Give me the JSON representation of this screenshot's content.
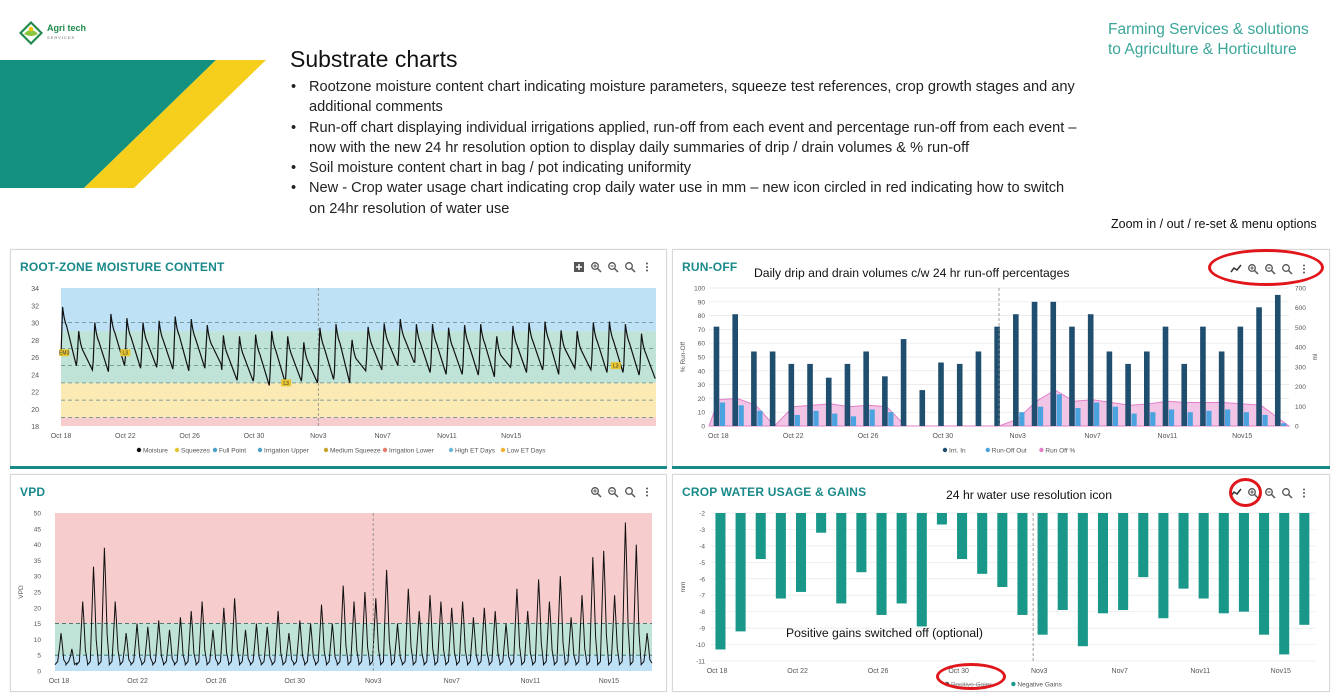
{
  "logo": {
    "name": "Agri tech",
    "sub": "SERVICES"
  },
  "tagline": {
    "line1": "Farming Services & solutions",
    "line2": "to Agriculture & Horticulture"
  },
  "slide": {
    "title": "Substrate charts",
    "bullets": [
      "Rootzone moisture content chart indicating moisture parameters, squeeze test references, crop growth stages and any additional comments",
      "Run-off chart displaying individual irrigations applied, run-off from each event and percentage run-off from each event – now with the new 24 hr resolution option to display daily summaries of drip / drain volumes & % run-off",
      "Soil moisture content chart in bag / pot indicating uniformity",
      "New - Crop water usage chart indicating crop daily water use in mm – new icon circled in red indicating how to switch on 24hr resolution of water use"
    ],
    "zoom_note": "Zoom in / out / re-set & menu options"
  },
  "panels": {
    "rootzone": {
      "title": "ROOT-ZONE MOISTURE CONTENT"
    },
    "runoff": {
      "title": "RUN-OFF",
      "annotation": "Daily drip and drain volumes  c/w 24 hr run-off percentages"
    },
    "vpd": {
      "title": "VPD"
    },
    "cwu": {
      "title": "CROP WATER USAGE & GAINS",
      "annotation": "24 hr water use resolution  icon",
      "annotation2": "Positive gains switched off (optional)"
    }
  },
  "colors": {
    "teal": "#19898a",
    "blue_band": "#bfe1f6",
    "green_band": "#bfe3d6",
    "yellow_band": "#fbeab4",
    "red_band": "#f6cccc",
    "drip_bar": "#1f4e6e",
    "runoff_bar": "#4aa3df",
    "runoff_pct": "#e27fc8",
    "cwu_bar": "#19988a",
    "ring": "#e0161b"
  },
  "icons": [
    "add-chart-icon",
    "zoom-in-icon",
    "zoom-out-icon",
    "zoom-reset-icon",
    "menu-icon",
    "resolution-24hr-icon"
  ],
  "chart_data": [
    {
      "id": "rootzone",
      "type": "line",
      "title": "ROOT-ZONE MOISTURE CONTENT",
      "x_ticks": [
        "Oct 18",
        "Oct 22",
        "Oct 26",
        "Oct 30",
        "Nov3",
        "Nov7",
        "Nov11",
        "Nov15"
      ],
      "y_ticks": [
        18,
        20,
        22,
        24,
        26,
        28,
        30,
        32,
        34
      ],
      "ylim": [
        18,
        34
      ],
      "bands": [
        {
          "from": 29,
          "to": 34,
          "color": "#bfe1f6"
        },
        {
          "from": 23,
          "to": 29,
          "color": "#bfe3d6"
        },
        {
          "from": 19,
          "to": 23,
          "color": "#fbeab4"
        },
        {
          "from": 18,
          "to": 19,
          "color": "#f6cccc"
        }
      ],
      "dashed_lines": [
        30,
        27,
        25,
        23,
        21,
        19
      ],
      "markers": [
        {
          "label": "EM3",
          "day": 0.2,
          "value": 26.5
        },
        {
          "label": "L3",
          "day": 4.0,
          "value": 26.5
        },
        {
          "label": "L3",
          "day": 14.0,
          "value": 23.0
        },
        {
          "label": "L3",
          "day": 34.5,
          "value": 25.0
        }
      ],
      "moisture_cycles": [
        [
          31.8,
          25.0
        ],
        [
          29.0,
          24.5
        ],
        [
          30.0,
          24.3
        ],
        [
          31.0,
          25.0
        ],
        [
          30.5,
          24.7
        ],
        [
          30.0,
          24.8
        ],
        [
          30.2,
          24.6
        ],
        [
          30.7,
          24.4
        ],
        [
          30.4,
          24.7
        ],
        [
          29.7,
          25.2
        ],
        [
          28.5,
          23.3
        ],
        [
          28.4,
          23.2
        ],
        [
          28.6,
          22.7
        ],
        [
          29.0,
          23.0
        ],
        [
          28.4,
          23.2
        ],
        [
          27.7,
          23.0
        ],
        [
          29.4,
          23.4
        ],
        [
          29.8,
          23.0
        ],
        [
          28.0,
          24.4
        ],
        [
          29.5,
          24.5
        ],
        [
          29.9,
          25.0
        ],
        [
          30.4,
          25.4
        ],
        [
          29.8,
          24.2
        ],
        [
          29.8,
          24.0
        ],
        [
          29.4,
          24.0
        ],
        [
          29.7,
          23.9
        ],
        [
          29.8,
          23.7
        ],
        [
          28.4,
          24.8
        ],
        [
          29.6,
          24.2
        ],
        [
          30.0,
          24.5
        ],
        [
          30.1,
          24.0
        ],
        [
          29.1,
          24.7
        ],
        [
          29.0,
          24.5
        ],
        [
          30.0,
          24.2
        ],
        [
          30.1,
          24.2
        ],
        [
          29.8,
          23.9
        ],
        [
          28.7,
          23.5
        ]
      ],
      "legend": [
        "Moisture",
        "Squeezes",
        "Full Point",
        "Irrigation Upper",
        "Medium Squeeze",
        "Irrigation Lower",
        "High ET Days",
        "Low ET Days"
      ],
      "legend_colors": [
        "#111111",
        "#e7c531",
        "#4aa0c8",
        "#4aa0c8",
        "#c7a22b",
        "#e47b6b",
        "#6bb8d7",
        "#f3b233"
      ]
    },
    {
      "id": "runoff",
      "type": "bar",
      "title": "RUN-OFF",
      "x_ticks": [
        "Oct 18",
        "Oct 22",
        "Oct 26",
        "Oct 30",
        "Nov3",
        "Nov7",
        "Nov11",
        "Nov15"
      ],
      "ylabel": "% Run-Off",
      "y2label": "ml",
      "ylim": [
        0,
        100
      ],
      "y_ticks": [
        0,
        10,
        20,
        30,
        40,
        50,
        60,
        70,
        80,
        90,
        100
      ],
      "y2lim": [
        0,
        700
      ],
      "y2_ticks": [
        0,
        100,
        200,
        300,
        400,
        500,
        600,
        700
      ],
      "series": [
        {
          "name": "Irri. In",
          "color": "#1f4e6e",
          "values": [
            72,
            81,
            54,
            54,
            45,
            45,
            35,
            45,
            54,
            36,
            63,
            26,
            46,
            45,
            54,
            72,
            81,
            90,
            90,
            72,
            81,
            54,
            45,
            54,
            72,
            45,
            72,
            54,
            72,
            86,
            95
          ]
        },
        {
          "name": "Run-Off Out",
          "color": "#4aa3df",
          "values": [
            17,
            15,
            11,
            0,
            8,
            11,
            9,
            7,
            12,
            10,
            0,
            0,
            0,
            0,
            0,
            0,
            10,
            14,
            23,
            13,
            17,
            14,
            9,
            10,
            12,
            10,
            11,
            12,
            10,
            8,
            2
          ]
        },
        {
          "name": "Run Off %",
          "color": "#e27fc8",
          "values": [
            19,
            20,
            15,
            0,
            14,
            15,
            16,
            14,
            15,
            14,
            0,
            0,
            0,
            0,
            0,
            0,
            5,
            18,
            26,
            18,
            19,
            17,
            15,
            16,
            18,
            17,
            17,
            17,
            16,
            15,
            5
          ]
        }
      ]
    },
    {
      "id": "vpd",
      "type": "line",
      "title": "VPD",
      "ylabel": "VPD",
      "x_ticks": [
        "Oct 18",
        "Oct 22",
        "Oct 26",
        "Oct 30",
        "Nov3",
        "Nov7",
        "Nov11",
        "Nov15"
      ],
      "y_ticks": [
        0,
        5,
        10,
        15,
        20,
        25,
        30,
        35,
        40,
        45,
        50
      ],
      "ylim": [
        0,
        50
      ],
      "bands": [
        {
          "from": 15,
          "to": 50,
          "color": "#f6cccc"
        },
        {
          "from": 5,
          "to": 15,
          "color": "#bfe3d6"
        },
        {
          "from": 0,
          "to": 5,
          "color": "#bfe1f6"
        }
      ],
      "dashed_lines": [
        15,
        5
      ],
      "daily_peaks": [
        12,
        7,
        22,
        33,
        39,
        22,
        12,
        15,
        14,
        16,
        13,
        17,
        19,
        22,
        13,
        20,
        23,
        13,
        15,
        14,
        19,
        12,
        16,
        15,
        21,
        15,
        27,
        22,
        25,
        23,
        32,
        15,
        26,
        19,
        24,
        22,
        20,
        22,
        17,
        20,
        19,
        15,
        26,
        19,
        29,
        22,
        30,
        17,
        24,
        36,
        38,
        24,
        47,
        40,
        12
      ]
    },
    {
      "id": "cwu",
      "type": "bar",
      "title": "CROP WATER USAGE & GAINS",
      "ylabel": "mm",
      "x_ticks": [
        "Oct 18",
        "Oct 22",
        "Oct 26",
        "Oct 30",
        "Nov3",
        "Nov7",
        "Nov11",
        "Nov15"
      ],
      "y_ticks": [
        -2,
        -3,
        -4,
        -5,
        -6,
        -7,
        -8,
        -9,
        -10,
        -11
      ],
      "ylim": [
        -11,
        -2
      ],
      "series": [
        {
          "name": "Positive Gains",
          "color": "#555555",
          "values": []
        },
        {
          "name": "Negative Gains",
          "color": "#19988a",
          "values": [
            -10.3,
            -9.2,
            -4.8,
            -7.2,
            -6.8,
            -3.2,
            -7.5,
            -5.6,
            -8.2,
            -7.5,
            -8.9,
            -2.7,
            -4.8,
            -5.7,
            -6.5,
            -8.2,
            -9.4,
            -7.9,
            -10.1,
            -8.1,
            -7.9,
            -5.9,
            -8.4,
            -6.6,
            -7.2,
            -8.1,
            -8.0,
            -9.4,
            -10.6,
            -8.8
          ]
        }
      ]
    }
  ]
}
